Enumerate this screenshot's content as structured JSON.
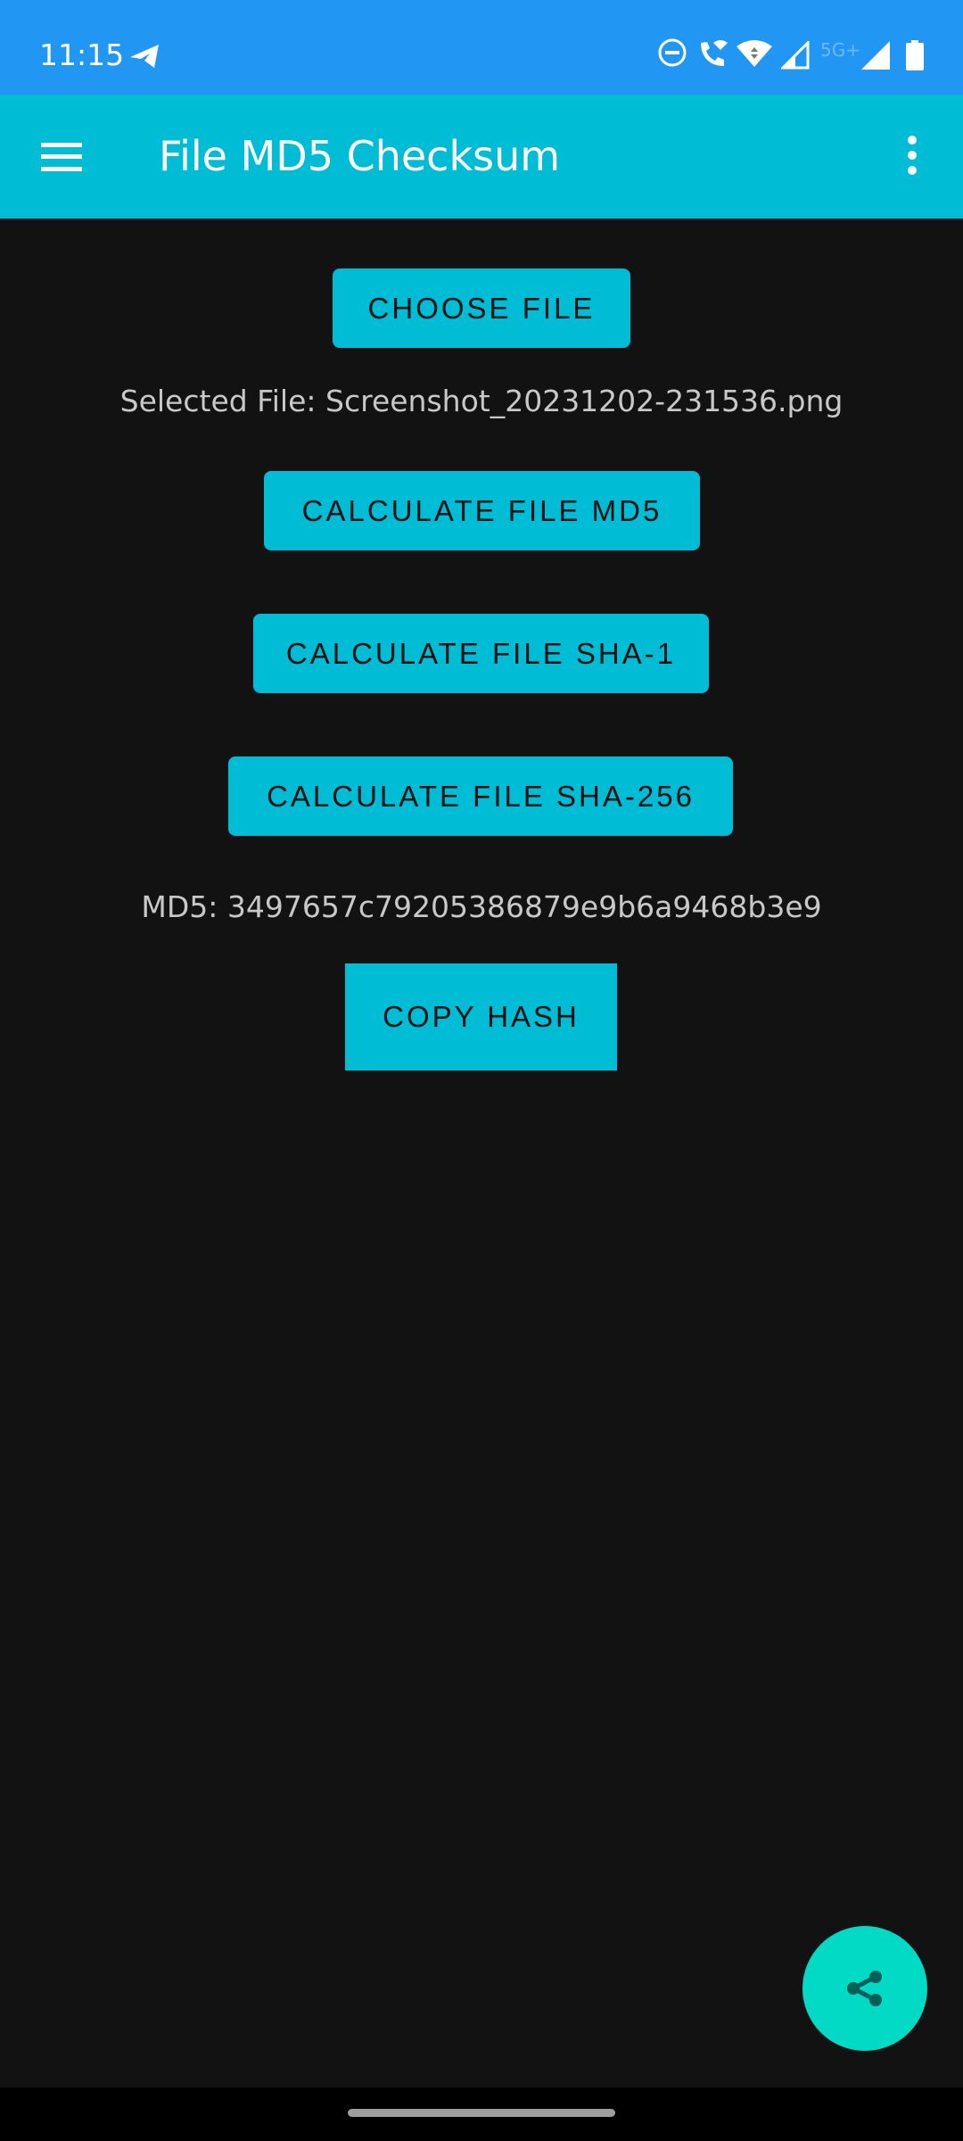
{
  "status_bar": {
    "time": "11:15",
    "network_label": "5G+",
    "icons": [
      "telegram-icon",
      "do-not-disturb-icon",
      "wifi-calling-icon",
      "wifi-icon",
      "signal-icon",
      "signal-full-icon",
      "battery-icon"
    ]
  },
  "app_bar": {
    "title": "File MD5 Checksum",
    "menu_icon": "hamburger-menu-icon",
    "overflow_icon": "more-vert-icon"
  },
  "main": {
    "choose_file_label": "CHOOSE FILE",
    "selected_file_text": "Selected File: Screenshot_20231202-231536.png",
    "calc_md5_label": "CALCULATE FILE MD5",
    "calc_sha1_label": "CALCULATE FILE SHA-1",
    "calc_sha256_label": "CALCULATE FILE SHA-256",
    "hash_result_text": "MD5: 3497657c79205386879e9b6a9468b3e9",
    "copy_hash_label": "COPY HASH"
  },
  "fab": {
    "icon": "share-icon"
  },
  "colors": {
    "status_bar": "#2196F3",
    "app_bar": "#00BCD4",
    "button": "#00BCD4",
    "fab": "#03DAC5",
    "background": "#121212"
  }
}
